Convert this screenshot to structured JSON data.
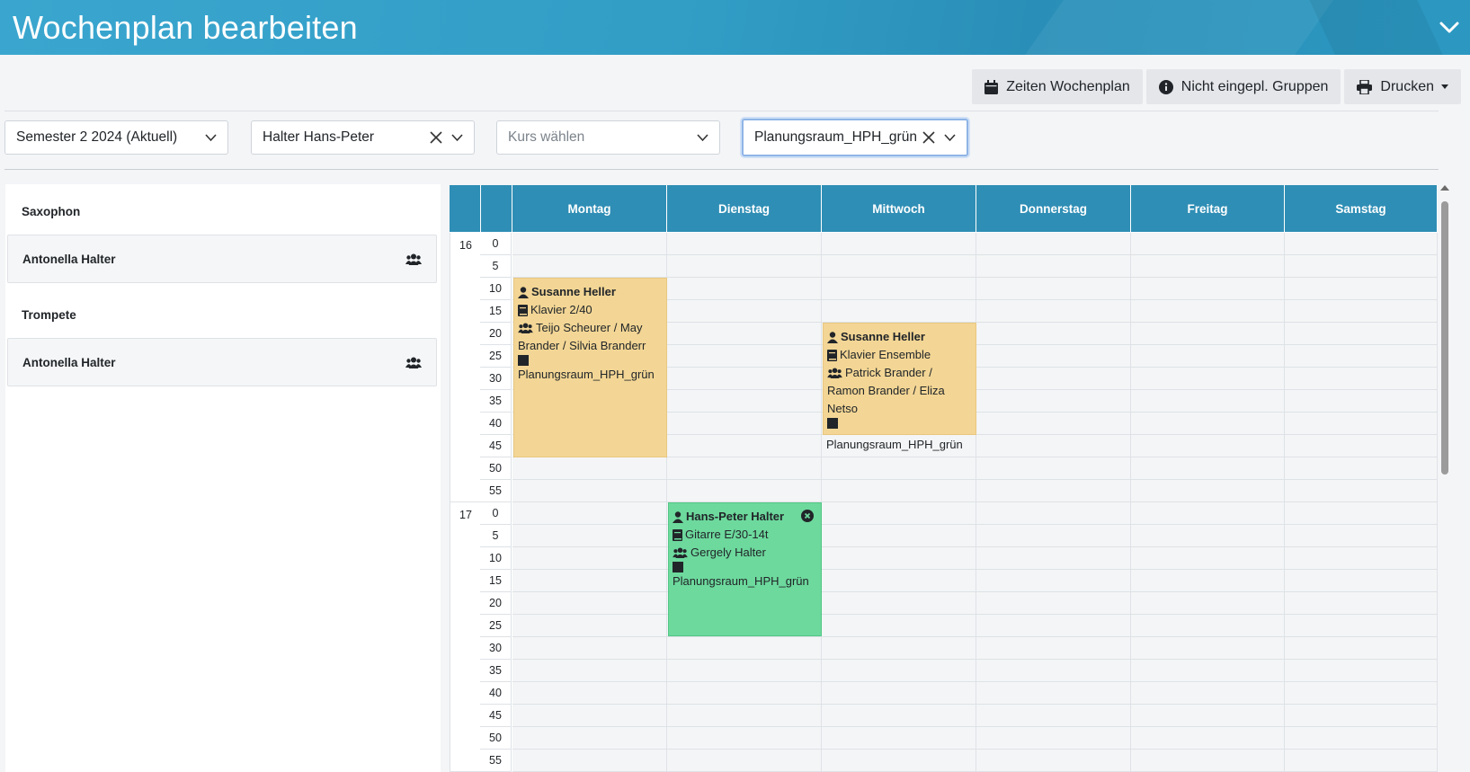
{
  "header": {
    "title": "Wochenplan bearbeiten"
  },
  "toolbar": {
    "times_label": "Zeiten Wochenplan",
    "unplanned_label": "Nicht eingepl. Gruppen",
    "print_label": "Drucken"
  },
  "filters": {
    "semester": "Semester 2 2024 (Aktuell)",
    "teacher": "Halter Hans-Peter",
    "course_placeholder": "Kurs wählen",
    "room": "Planungsraum_HPH_grün"
  },
  "groups": [
    {
      "title": "Saxophon",
      "student": "Antonella Halter"
    },
    {
      "title": "Trompete",
      "student": "Antonella Halter"
    }
  ],
  "calendar": {
    "days": [
      "Montag",
      "Dienstag",
      "Mittwoch",
      "Donnerstag",
      "Freitag",
      "Samstag"
    ],
    "hours": [
      "16",
      "17"
    ],
    "minutes": [
      "0",
      "5",
      "10",
      "15",
      "20",
      "25",
      "30",
      "35",
      "40",
      "45",
      "50",
      "55"
    ],
    "events": [
      {
        "teacher": "Susanne Heller",
        "course": "Klavier 2/40",
        "students_line1": "Teijo Scheurer / May",
        "students_line2": "Brander / Silvia Branderr",
        "room": "Planungsraum_HPH_grün",
        "color": "#f3d695"
      },
      {
        "teacher": "Susanne Heller",
        "course": "Klavier Ensemble",
        "students_line1": "Patrick Brander /",
        "students_line2": "Ramon Brander / Eliza",
        "students_line3": "Netso",
        "room": "Planungsraum_HPH_grün",
        "color": "#f3d695"
      },
      {
        "teacher": "Hans-Peter Halter",
        "course": "Gitarre E/30-14t",
        "students_line1": "Gergely Halter",
        "room": "Planungsraum_HPH_grün",
        "color": "#6dd99d"
      }
    ]
  },
  "colors": {
    "header_bg": "#3aa6cf",
    "day_header_bg": "#2f8eb5",
    "event_yellow": "#f3d695",
    "event_green": "#6dd99d"
  }
}
